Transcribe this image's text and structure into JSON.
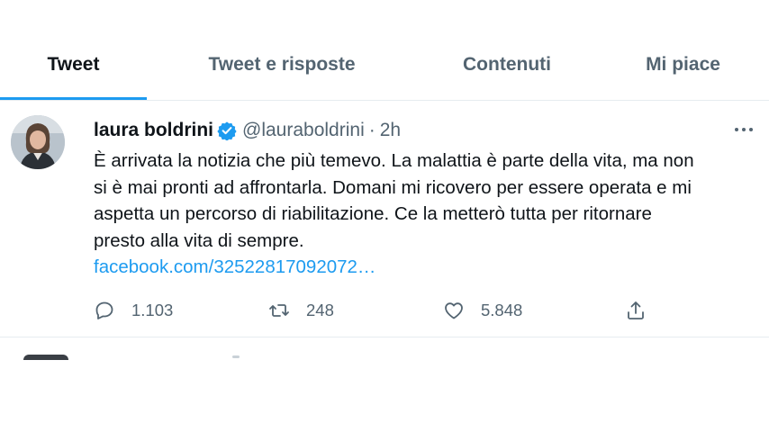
{
  "tabs": [
    {
      "label": "Tweet",
      "active": true
    },
    {
      "label": "Tweet e risposte",
      "active": false
    },
    {
      "label": "Contenuti",
      "active": false
    },
    {
      "label": "Mi piace",
      "active": false
    }
  ],
  "tweet": {
    "display_name": "laura boldrini",
    "verified_icon": "verified-badge-icon",
    "handle": "@lauraboldrini",
    "separator": "·",
    "time": "2h",
    "text_lines": [
      "È arrivata la notizia che più temevo. La malattia è parte della vita, ma non",
      "si è mai pronti ad affrontarla. Domani mi ricovero per essere operata e mi",
      "aspetta un percorso di riabilitazione. Ce la metterò tutta per ritornare",
      "presto alla vita di sempre."
    ],
    "link": "facebook.com/32522817092072…",
    "actions": {
      "reply_count": "1.103",
      "retweet_count": "248",
      "like_count": "5.848"
    }
  },
  "colors": {
    "accent": "#1d9bf0",
    "text": "#0f1419",
    "secondary_text": "#536471",
    "divider": "#e6ecf0"
  }
}
